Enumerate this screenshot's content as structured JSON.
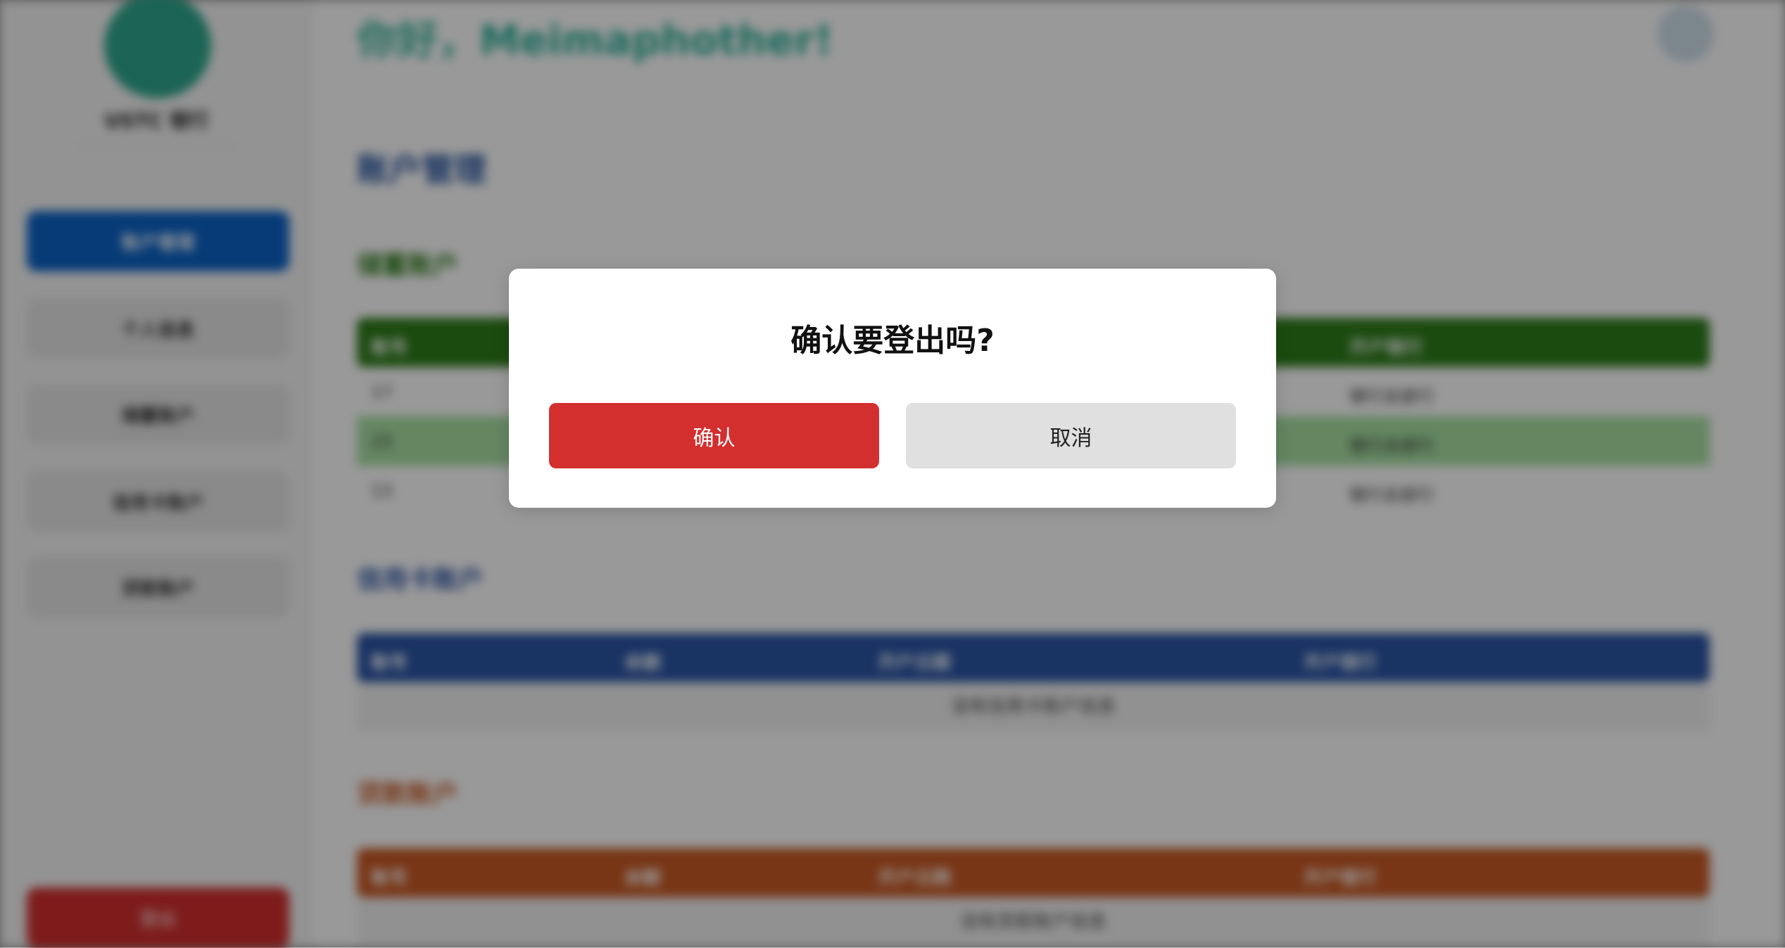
{
  "colors": {
    "brand_teal": "#2fa88f",
    "nav_active": "#0b63c7",
    "danger": "#d32f2f",
    "section_blue": "#1f4e9e",
    "green_header": "#2e7d1a",
    "blue_header": "#2a55a6",
    "orange_header": "#c85a25",
    "cancel_bg": "#e0e0e0"
  },
  "sidebar": {
    "brand": "USTC 银行",
    "nav": [
      {
        "label": "账户管理",
        "active": true
      },
      {
        "label": "个人信息"
      },
      {
        "label": "储蓄账户"
      },
      {
        "label": "信用卡账户"
      },
      {
        "label": "贷款账户"
      }
    ],
    "logout_label": "登出"
  },
  "main": {
    "greeting": "你好，Meimaphother!",
    "section_title": "账户管理",
    "savings": {
      "title": "储蓄账户",
      "headers": [
        "账号",
        "",
        "",
        "开户银行"
      ],
      "rows": [
        {
          "id": "17",
          "bank": "银行总部行"
        },
        {
          "id": "15",
          "bank": "银行总部行"
        },
        {
          "id": "13",
          "bank": "银行总部行"
        }
      ]
    },
    "credit": {
      "title": "信用卡账户",
      "headers": [
        "账号",
        "余额",
        "开户日期",
        "开户银行"
      ],
      "empty": "没有信用卡账户信息"
    },
    "loan": {
      "title": "贷款账户",
      "headers": [
        "账号",
        "余额",
        "开户日期",
        "开户银行"
      ],
      "empty": "没有贷款账户信息"
    }
  },
  "dialog": {
    "title": "确认要登出吗?",
    "confirm_label": "确认",
    "cancel_label": "取消"
  }
}
